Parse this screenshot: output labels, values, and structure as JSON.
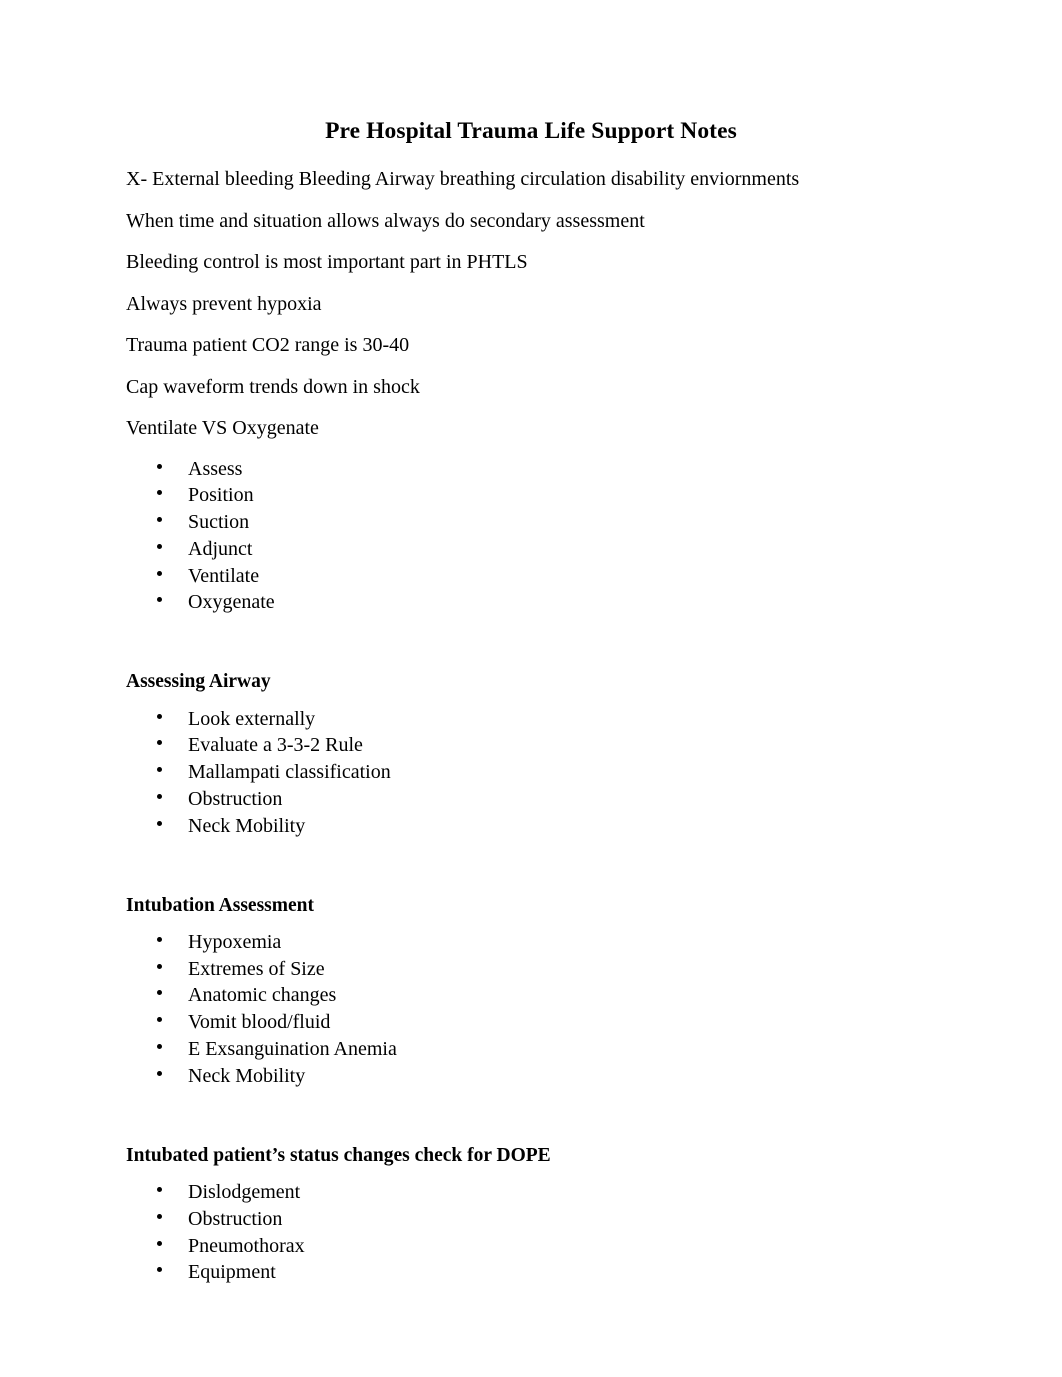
{
  "document": {
    "title": "Pre Hospital Trauma Life Support Notes",
    "paragraphs": [
      "X- External bleeding Bleeding Airway breathing circulation disability enviornments",
      "When time and situation allows always do secondary assessment",
      "Bleeding control is most important part in PHTLS",
      "Always prevent hypoxia",
      "Trauma patient CO2 range is 30-40",
      "Cap waveform trends down in shock",
      "Ventilate VS Oxygenate"
    ],
    "intro_list": [
      "Assess",
      "Position",
      "Suction",
      "Adjunct",
      "Ventilate",
      "Oxygenate"
    ],
    "sections": [
      {
        "heading": "Assessing Airway",
        "items": [
          "Look externally",
          "Evaluate a 3-3-2 Rule",
          "Mallampati classification",
          "Obstruction",
          "Neck Mobility"
        ]
      },
      {
        "heading": "Intubation Assessment",
        "items": [
          "Hypoxemia",
          "Extremes of Size",
          "Anatomic changes",
          "Vomit blood/fluid",
          "E Exsanguination Anemia",
          "Neck Mobility"
        ]
      },
      {
        "heading": "Intubated patient’s status changes check for DOPE",
        "items": [
          "Dislodgement",
          "Obstruction",
          "Pneumothorax",
          "Equipment"
        ]
      }
    ],
    "bullet_glyph": "bullet-dot-icon",
    "text_color": "#000000",
    "page_background": "#ffffff"
  }
}
